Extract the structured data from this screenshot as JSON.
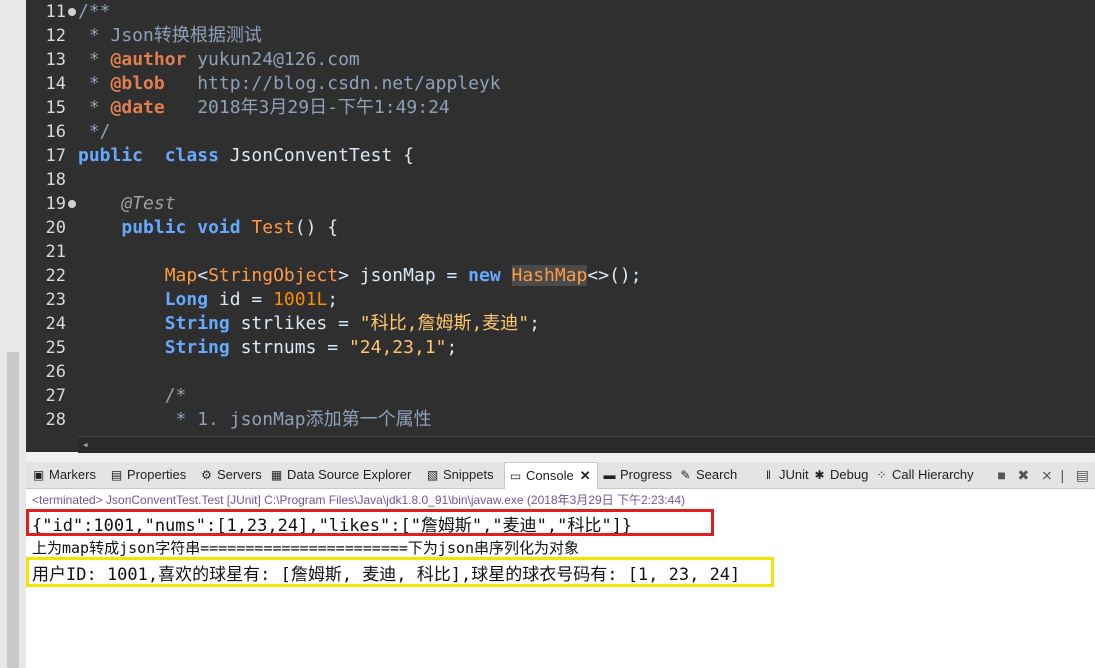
{
  "editor": {
    "lines": [
      {
        "num": "11",
        "fold": true,
        "parts": [
          [
            "cm",
            "/**"
          ]
        ]
      },
      {
        "num": "12",
        "parts": [
          [
            "cm",
            " * Json转换根据测试"
          ]
        ]
      },
      {
        "num": "13",
        "parts": [
          [
            "cm",
            " * "
          ],
          [
            "doctag",
            "@author"
          ],
          [
            "cm",
            " yukun24@126.com"
          ]
        ]
      },
      {
        "num": "14",
        "parts": [
          [
            "cm",
            " * "
          ],
          [
            "doctag",
            "@blob"
          ],
          [
            "cm",
            "   http://blog.csdn.net/appleyk"
          ]
        ]
      },
      {
        "num": "15",
        "parts": [
          [
            "cm",
            " * "
          ],
          [
            "doctag",
            "@date"
          ],
          [
            "cm",
            "   2018年3月29日-下午1:49:24"
          ]
        ]
      },
      {
        "num": "16",
        "parts": [
          [
            "cm",
            " */"
          ]
        ]
      },
      {
        "num": "17",
        "parts": [
          [
            "kw",
            "public"
          ],
          [
            "",
            "  "
          ],
          [
            "kw",
            "class"
          ],
          [
            "",
            " JsonConventTest {"
          ]
        ]
      },
      {
        "num": "18",
        "parts": []
      },
      {
        "num": "19",
        "fold": true,
        "parts": [
          [
            "",
            "    "
          ],
          [
            "ann",
            "@Test"
          ]
        ]
      },
      {
        "num": "20",
        "parts": [
          [
            "",
            "    "
          ],
          [
            "kw",
            "public"
          ],
          [
            "",
            " "
          ],
          [
            "kw",
            "void"
          ],
          [
            "",
            " "
          ],
          [
            "cls",
            "Test"
          ],
          [
            "",
            "() {"
          ]
        ]
      },
      {
        "num": "21",
        "parts": []
      },
      {
        "num": "22",
        "parts": [
          [
            "",
            "        "
          ],
          [
            "cls",
            "Map"
          ],
          [
            "",
            "<"
          ],
          [
            "cls",
            "String"
          ],
          [
            ", "
          ],
          [
            "cls",
            "Object"
          ],
          [
            "",
            "> jsonMap = "
          ],
          [
            "kw",
            "new"
          ],
          [
            "",
            " "
          ],
          [
            "hl",
            "HashMap"
          ],
          [
            "",
            "<>();"
          ]
        ]
      },
      {
        "num": "23",
        "parts": [
          [
            "",
            "        "
          ],
          [
            "kw",
            "Long"
          ],
          [
            "",
            " id = "
          ],
          [
            "num",
            "1001L"
          ],
          [
            "",
            ";"
          ]
        ]
      },
      {
        "num": "24",
        "parts": [
          [
            "",
            "        "
          ],
          [
            "kw",
            "String"
          ],
          [
            "",
            " strlikes = "
          ],
          [
            "str",
            "\"科比,詹姆斯,麦迪\""
          ],
          [
            "",
            ";"
          ]
        ]
      },
      {
        "num": "25",
        "parts": [
          [
            "",
            "        "
          ],
          [
            "kw",
            "String"
          ],
          [
            "",
            " strnums = "
          ],
          [
            "str",
            "\"24,23,1\""
          ],
          [
            "",
            ";"
          ]
        ]
      },
      {
        "num": "26",
        "parts": []
      },
      {
        "num": "27",
        "parts": [
          [
            "",
            "        "
          ],
          [
            "cm",
            "/*"
          ]
        ]
      },
      {
        "num": "28",
        "parts": [
          [
            "",
            "         "
          ],
          [
            "cm",
            "* 1. jsonMap添加第一个属性"
          ]
        ]
      }
    ]
  },
  "tabs": [
    {
      "label": "Markers",
      "icon": "▣"
    },
    {
      "label": "Properties",
      "icon": "▤"
    },
    {
      "label": "Servers",
      "icon": "⚙"
    },
    {
      "label": "Data Source Explorer",
      "icon": "▦"
    },
    {
      "label": "Snippets",
      "icon": "▧"
    },
    {
      "label": "Console",
      "icon": "▭",
      "active": true
    },
    {
      "label": "Progress",
      "icon": "▬"
    },
    {
      "label": "Search",
      "icon": "✎"
    },
    {
      "label": "JUnit",
      "icon": "ǁ"
    },
    {
      "label": "Debug",
      "icon": "✱"
    },
    {
      "label": "Call Hierarchy",
      "icon": "⁘"
    }
  ],
  "console": {
    "terminated": "<terminated> JsonConventTest.Test [JUnit] C:\\Program Files\\Java\\jdk1.8.0_91\\bin\\javaw.exe (2018年3月29日 下午2:23:44)",
    "line1": "{\"id\":1001,\"nums\":[1,23,24],\"likes\":[\"詹姆斯\",\"麦迪\",\"科比\"]}",
    "line2": "上为map转成json字符串=======================下为json串序列化为对象",
    "line3": "用户ID: 1001,喜欢的球星有: [詹姆斯, 麦迪, 科比],球星的球衣号码有: [1, 23, 24]"
  }
}
